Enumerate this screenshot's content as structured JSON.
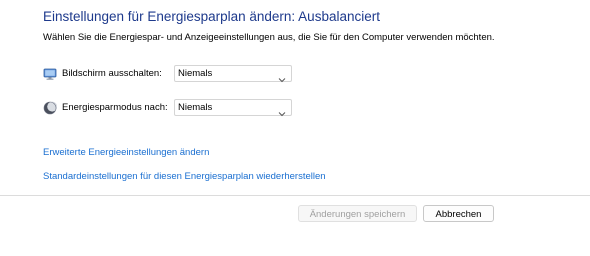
{
  "title": "Einstellungen für Energiesparplan ändern: Ausbalanciert",
  "subtitle": "Wählen Sie die Energiespar- und Anzeigeeinstellungen aus, die Sie für den Computer verwenden möchten.",
  "settings": [
    {
      "label": "Bildschirm ausschalten:",
      "value": "Niemals",
      "icon": "monitor-icon"
    },
    {
      "label": "Energiesparmodus nach:",
      "value": "Niemals",
      "icon": "moon-icon"
    }
  ],
  "links": {
    "advanced": "Erweiterte Energieeinstellungen ändern",
    "restore": "Standardeinstellungen für diesen Energiesparplan wiederherstellen"
  },
  "buttons": {
    "save": "Änderungen speichern",
    "save_enabled": false,
    "cancel": "Abbrechen"
  },
  "colors": {
    "title": "#1e3a8c",
    "link": "#1a6fd1",
    "disabled_text": "#a0a0a0"
  }
}
